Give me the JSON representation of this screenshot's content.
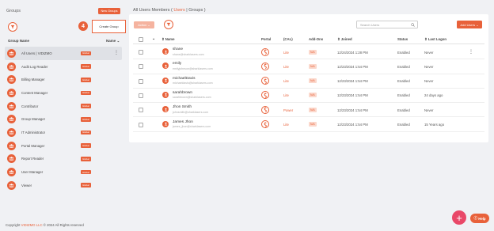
{
  "colors": {
    "accent": "#e8613a",
    "fab": "#e94868"
  },
  "sidebar": {
    "title": "Groups",
    "new_groups_label": "New Groups",
    "step_number": "4",
    "create_group_label": "Create Group",
    "col_group_name": "Group Name",
    "col_name_sort": "Name ⌄",
    "badge_label": "Global",
    "groups": [
      {
        "name": "All Users | VIDIZMO",
        "selected": true
      },
      {
        "name": "Audit Log Reader"
      },
      {
        "name": "Billing Manager"
      },
      {
        "name": "Content Manager"
      },
      {
        "name": "Contributor"
      },
      {
        "name": "Group Manager"
      },
      {
        "name": "IT Administrator"
      },
      {
        "name": "Portal Manager"
      },
      {
        "name": "Report Reader"
      },
      {
        "name": "User Manager"
      },
      {
        "name": "Viewer"
      }
    ]
  },
  "main": {
    "breadcrumb_prefix": "All Users Members ( ",
    "breadcrumb_users": "Users",
    "breadcrumb_suffix": " | Groups )",
    "actions_label": "Action ⌄",
    "search_placeholder": "Search Users",
    "add_users_label": "Add Users ⌄",
    "columns": {
      "name": "⇕ Name",
      "portal": "Portal",
      "cal": "(CAL)",
      "addons": "Add-Ons",
      "joined": "⇕ Joined",
      "status": "Status",
      "last_logon": "⇕ Last Logon"
    },
    "users": [
      {
        "name": "shane",
        "email": "shane@sharklasers.com",
        "cal": "Lite",
        "addons": "N/A",
        "joined": "12/24/2024 1:28 PM",
        "status": "Enabled",
        "last_logon": "Never",
        "menu": true
      },
      {
        "name": "emily",
        "email": "emilyjohnson@sharklasers.com",
        "cal": "Lite",
        "addons": "N/A",
        "joined": "12/23/2024 1:54 PM",
        "status": "Enabled",
        "last_logon": "Never"
      },
      {
        "name": "michaelDavis",
        "email": "michaeldavis@sharklasers.com",
        "cal": "Lite",
        "addons": "N/A",
        "joined": "12/23/2024 1:54 PM",
        "status": "Enabled",
        "last_logon": "Never"
      },
      {
        "name": "sarahbrown",
        "email": "sarahbrown@sharklasers.com",
        "cal": "Lite",
        "addons": "N/A",
        "joined": "12/23/2024 1:54 PM",
        "status": "Enabled",
        "last_logon": "24 days ago"
      },
      {
        "name": "Jhon Smith",
        "email": "johnsmith@sharklasers.com",
        "cal": "Power",
        "addons": "N/A",
        "joined": "12/23/2024 1:54 PM",
        "status": "Enabled",
        "last_logon": "Never"
      },
      {
        "name": "James Jhon",
        "email": "james_jhon@sharklasers.com",
        "cal": "Lite",
        "addons": "N/A",
        "joined": "12/23/2024 1:54 PM",
        "status": "Enabled",
        "last_logon": "15 Years ago"
      }
    ]
  },
  "footer": {
    "copyright_prefix": "Copyright ",
    "copyright_brand": "VIDIZMO LLC",
    "copyright_suffix": " © 2024 All Rights reserved",
    "help_label": "Help",
    "fab_label": "+"
  }
}
